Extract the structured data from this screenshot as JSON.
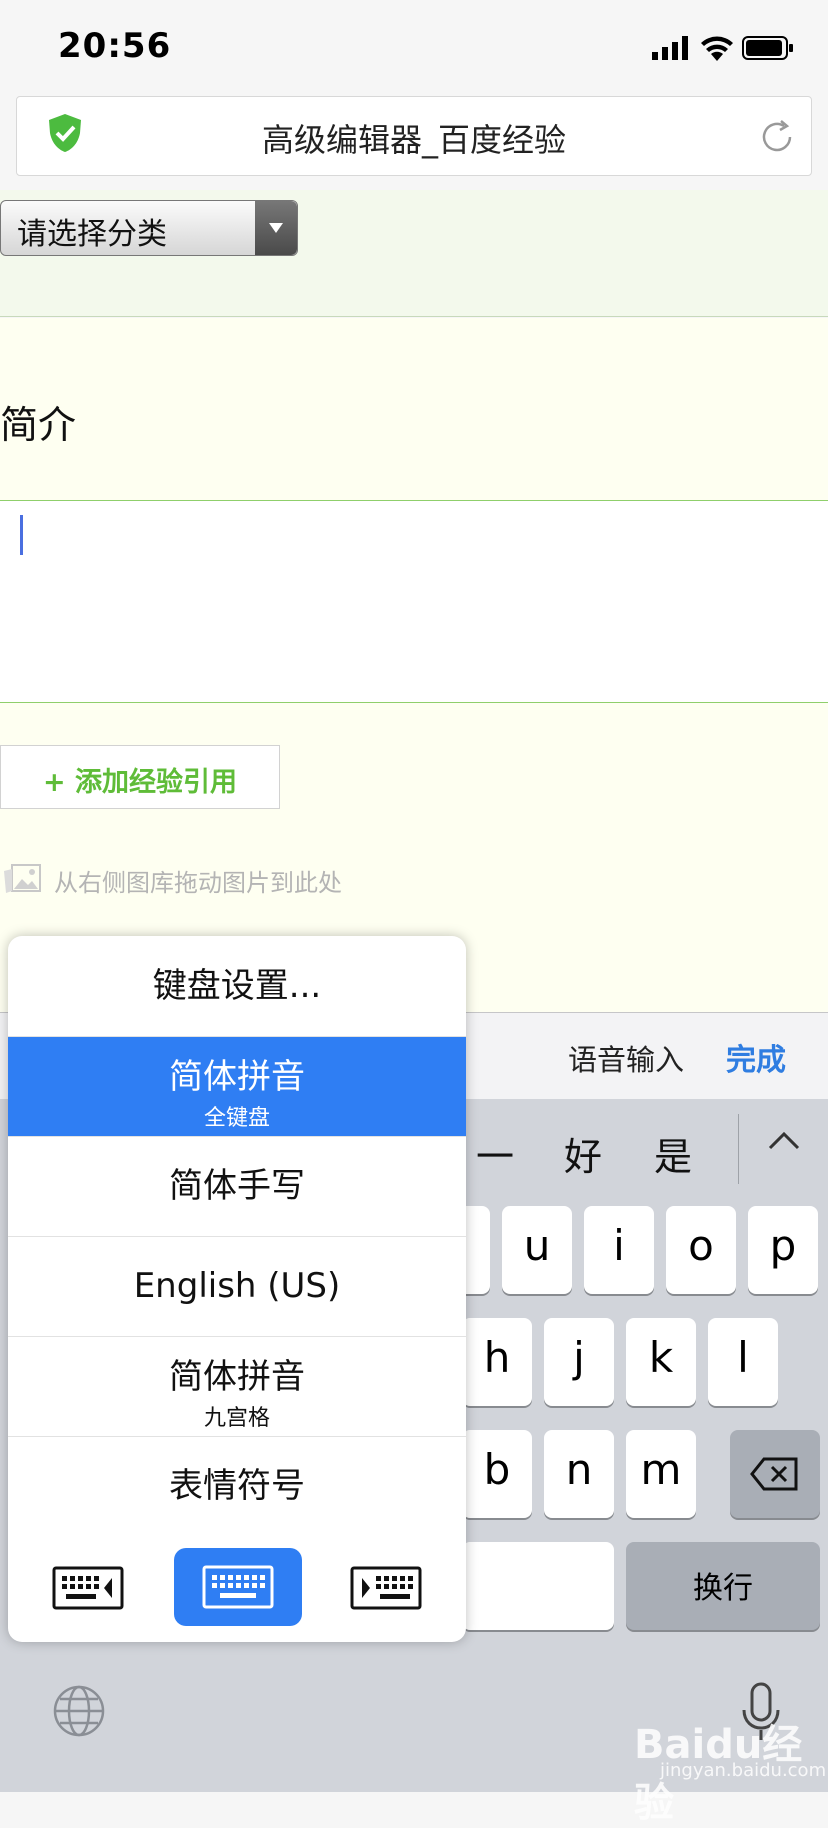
{
  "status_bar": {
    "time": "20:56"
  },
  "browser": {
    "title": "高级编辑器_百度经验"
  },
  "category": {
    "placeholder": "请选择分类"
  },
  "intro": {
    "heading": "简介"
  },
  "add_reference": {
    "label": "+ 添加经验引用"
  },
  "drag_hint": "从右侧图库拖动图片到此处",
  "keyboard_toolbar": {
    "voice_input": "语音输入",
    "done": "完成"
  },
  "candidates": [
    "一",
    "好",
    "是"
  ],
  "keys": {
    "row1": [
      "u",
      "i",
      "o",
      "p"
    ],
    "row2": [
      "h",
      "j",
      "k",
      "l"
    ],
    "row3": [
      "b",
      "n",
      "m"
    ],
    "return": "换行"
  },
  "popup": {
    "items": [
      {
        "main": "键盘设置...",
        "sub": ""
      },
      {
        "main": "简体拼音",
        "sub": "全键盘",
        "selected": true
      },
      {
        "main": "简体手写",
        "sub": ""
      },
      {
        "main": "English (US)",
        "sub": ""
      },
      {
        "main": "简体拼音",
        "sub": "九宫格"
      },
      {
        "main": "表情符号",
        "sub": ""
      }
    ]
  },
  "watermark": {
    "brand": "Baidu经验",
    "url": "jingyan.baidu.com"
  },
  "colors": {
    "accent_blue": "#2f7ef3",
    "green": "#5fbc38",
    "done_blue": "#2f7de1"
  }
}
